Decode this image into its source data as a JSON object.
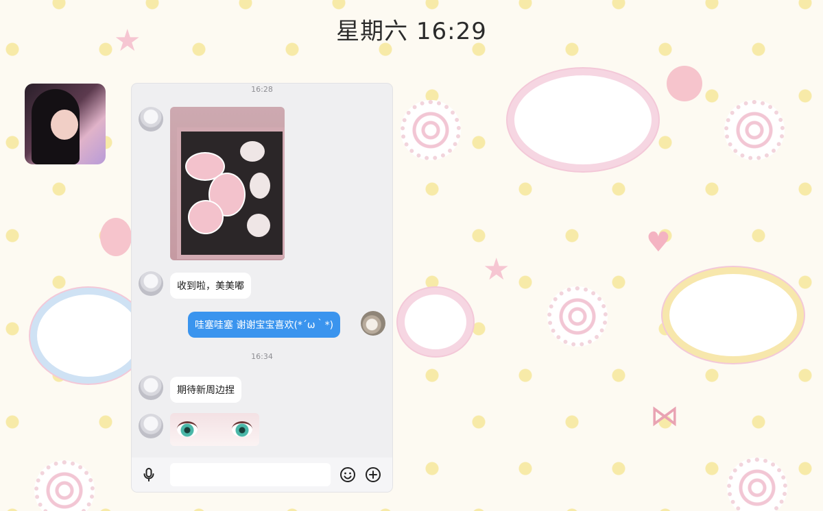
{
  "status_bar": {
    "time": "星期六 16:29"
  },
  "chat": {
    "messages": [
      {
        "type": "time",
        "text": "16:28"
      },
      {
        "type": "image",
        "from": "other"
      },
      {
        "type": "text",
        "from": "other",
        "text": "收到啦，美美嘟"
      },
      {
        "type": "text",
        "from": "self",
        "text": "哇塞哇塞 谢谢宝宝喜欢(*´ω｀*)"
      },
      {
        "type": "time",
        "text": "16:34"
      },
      {
        "type": "text",
        "from": "other",
        "text": "期待新周边捏"
      },
      {
        "type": "sticker",
        "from": "other"
      }
    ]
  },
  "input_bar": {
    "voice_icon": "microphone-icon",
    "emoji_icon": "smiley-icon",
    "more_icon": "plus-circle-icon",
    "value": ""
  },
  "colors": {
    "self_bubble": "#3a94ee",
    "other_bubble": "#ffffff",
    "panel_bg": "#efeff1",
    "wallpaper": "#fdfaf2"
  }
}
